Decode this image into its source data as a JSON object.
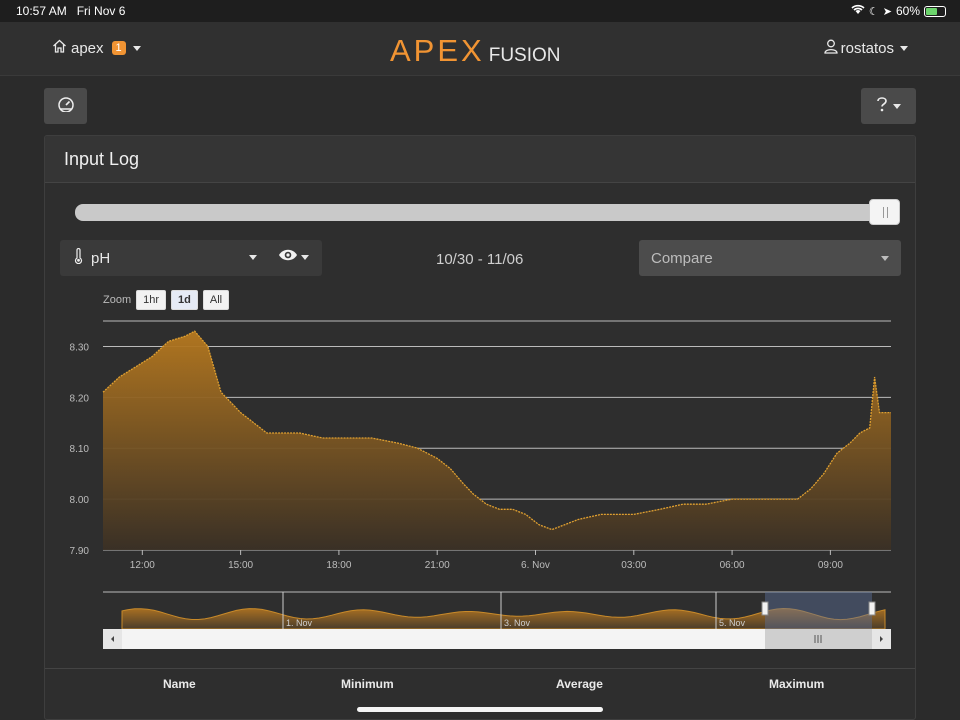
{
  "status": {
    "time": "10:57 AM",
    "date": "Fri Nov 6",
    "battery": "60%",
    "battery_level": 0.6
  },
  "nav": {
    "apex_label": "apex",
    "badge_count": "1",
    "logo_apex": "APEX",
    "logo_fusion": "FUSION",
    "user": "rostatos"
  },
  "panel": {
    "title": "Input Log"
  },
  "slider": {
    "value": 1.0
  },
  "controls": {
    "probe": "pH",
    "date_range": "10/30 - 11/06",
    "compare_placeholder": "Compare"
  },
  "zoom": {
    "label": "Zoom",
    "options": [
      "1hr",
      "1d",
      "All"
    ],
    "selected": "1d"
  },
  "table": {
    "headers": [
      "Name",
      "Minimum",
      "Average",
      "Maximum"
    ]
  },
  "colors": {
    "accent": "#f19433",
    "series": "#d4952a"
  },
  "chart_data": {
    "type": "area",
    "ylim": [
      7.9,
      8.35
    ],
    "y_ticks": [
      "7.90",
      "8.00",
      "8.10",
      "8.20",
      "8.30"
    ],
    "x_ticks": [
      "12:00",
      "15:00",
      "18:00",
      "21:00",
      "6. Nov",
      "03:00",
      "06:00",
      "09:00"
    ],
    "x_hours": [
      12,
      15,
      18,
      21,
      24,
      27,
      30,
      33
    ],
    "xlim": [
      10.8,
      34.85
    ],
    "series": [
      {
        "x": [
          10.8,
          11.3,
          11.8,
          12.3,
          12.8,
          13.3,
          13.6,
          14.0,
          14.4,
          14.7,
          15.0,
          15.4,
          15.8,
          16.2,
          16.8,
          17.5,
          18.2,
          19.0,
          19.8,
          20.4,
          21.0,
          21.4,
          21.8,
          22.1,
          22.5,
          22.9,
          23.3,
          23.7,
          24.1,
          24.5,
          24.9,
          25.3,
          26.0,
          27.0,
          27.8,
          28.5,
          29.2,
          30.0,
          30.8,
          31.5,
          32.0,
          32.4,
          32.8,
          33.2,
          33.6,
          33.9,
          34.2,
          34.35,
          34.5,
          34.85
        ],
        "y": [
          8.21,
          8.24,
          8.26,
          8.28,
          8.31,
          8.32,
          8.33,
          8.3,
          8.21,
          8.19,
          8.17,
          8.15,
          8.13,
          8.13,
          8.13,
          8.12,
          8.12,
          8.12,
          8.11,
          8.1,
          8.08,
          8.06,
          8.03,
          8.01,
          7.99,
          7.98,
          7.98,
          7.97,
          7.95,
          7.94,
          7.95,
          7.96,
          7.97,
          7.97,
          7.98,
          7.99,
          7.99,
          8.0,
          8.0,
          8.0,
          8.0,
          8.02,
          8.05,
          8.09,
          8.11,
          8.13,
          8.14,
          8.24,
          8.17,
          8.17
        ]
      }
    ],
    "navigator_labels": [
      "1. Nov",
      "3. Nov",
      "5. Nov"
    ]
  }
}
